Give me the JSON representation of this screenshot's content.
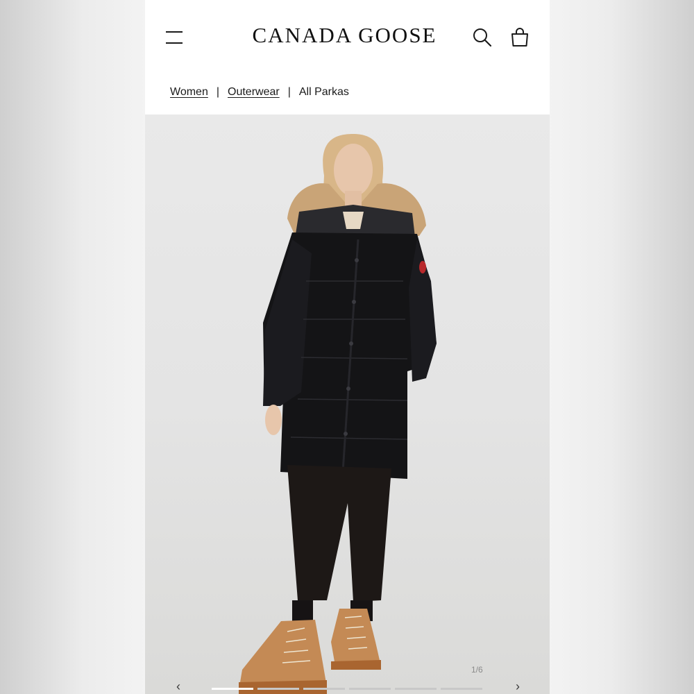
{
  "header": {
    "brand": "CANADA GOOSE",
    "menu_icon": "hamburger-menu-icon",
    "search_icon": "search-icon",
    "cart_icon": "shopping-bag-icon"
  },
  "breadcrumb": {
    "items": [
      "Women",
      "Outerwear",
      "All Parkas"
    ],
    "separator": "|"
  },
  "gallery": {
    "counter": "1/6",
    "current": 1,
    "total": 6,
    "prev_icon": "chevron-left-icon",
    "next_icon": "chevron-right-icon",
    "prev_glyph": "‹",
    "next_glyph": "›"
  },
  "colors": {
    "background": "#f3f3f3",
    "text": "#1a1a1a",
    "jacket": "#141416",
    "fur": "#c9a477",
    "boots": "#c48a55"
  }
}
